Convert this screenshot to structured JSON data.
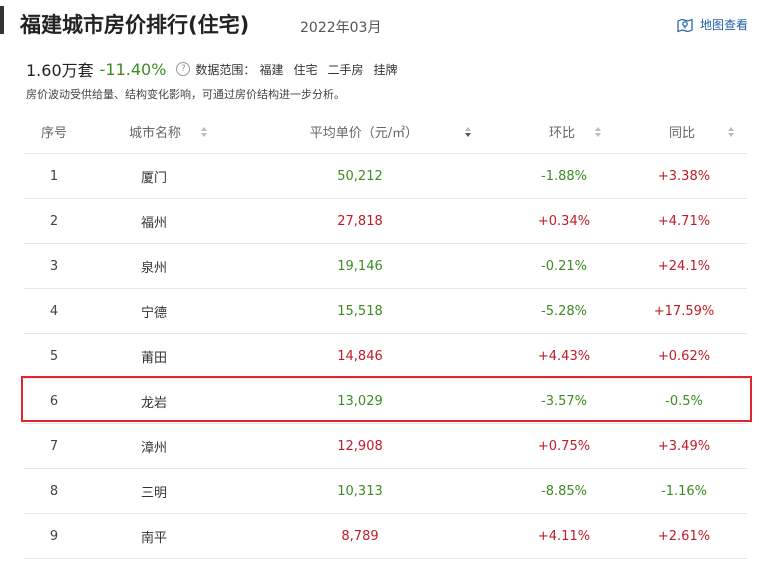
{
  "header": {
    "title": "福建城市房价排行(住宅)",
    "date": "2022年03月",
    "map_link": "地图查看"
  },
  "summary": {
    "count": "1.60万套",
    "change": "-11.40%",
    "range_label": "数据范围：",
    "range_tags": [
      "福建",
      "住宅",
      "二手房",
      "挂牌"
    ]
  },
  "note": "房价波动受供给量、结构变化影响，可通过房价结构进一步分析。",
  "colors": {
    "up": "#c01c28",
    "down": "#3e8a24",
    "link": "#1f5faa",
    "highlight": "#e0262c"
  },
  "table": {
    "columns": [
      "序号",
      "城市名称",
      "平均单价（元/㎡）",
      "环比",
      "同比"
    ],
    "rows": [
      {
        "idx": "1",
        "city": "厦门",
        "price": "50,212",
        "price_trend": "down",
        "mom": "-1.88%",
        "mom_trend": "down",
        "yoy": "+3.38%",
        "yoy_trend": "up"
      },
      {
        "idx": "2",
        "city": "福州",
        "price": "27,818",
        "price_trend": "up",
        "mom": "+0.34%",
        "mom_trend": "up",
        "yoy": "+4.71%",
        "yoy_trend": "up"
      },
      {
        "idx": "3",
        "city": "泉州",
        "price": "19,146",
        "price_trend": "down",
        "mom": "-0.21%",
        "mom_trend": "down",
        "yoy": "+24.1%",
        "yoy_trend": "up"
      },
      {
        "idx": "4",
        "city": "宁德",
        "price": "15,518",
        "price_trend": "down",
        "mom": "-5.28%",
        "mom_trend": "down",
        "yoy": "+17.59%",
        "yoy_trend": "up"
      },
      {
        "idx": "5",
        "city": "莆田",
        "price": "14,846",
        "price_trend": "up",
        "mom": "+4.43%",
        "mom_trend": "up",
        "yoy": "+0.62%",
        "yoy_trend": "up"
      },
      {
        "idx": "6",
        "city": "龙岩",
        "price": "13,029",
        "price_trend": "down",
        "mom": "-3.57%",
        "mom_trend": "down",
        "yoy": "-0.5%",
        "yoy_trend": "down"
      },
      {
        "idx": "7",
        "city": "漳州",
        "price": "12,908",
        "price_trend": "up",
        "mom": "+0.75%",
        "mom_trend": "up",
        "yoy": "+3.49%",
        "yoy_trend": "up"
      },
      {
        "idx": "8",
        "city": "三明",
        "price": "10,313",
        "price_trend": "down",
        "mom": "-8.85%",
        "mom_trend": "down",
        "yoy": "-1.16%",
        "yoy_trend": "down"
      },
      {
        "idx": "9",
        "city": "南平",
        "price": "8,789",
        "price_trend": "up",
        "mom": "+4.11%",
        "mom_trend": "up",
        "yoy": "+2.61%",
        "yoy_trend": "up"
      }
    ]
  }
}
